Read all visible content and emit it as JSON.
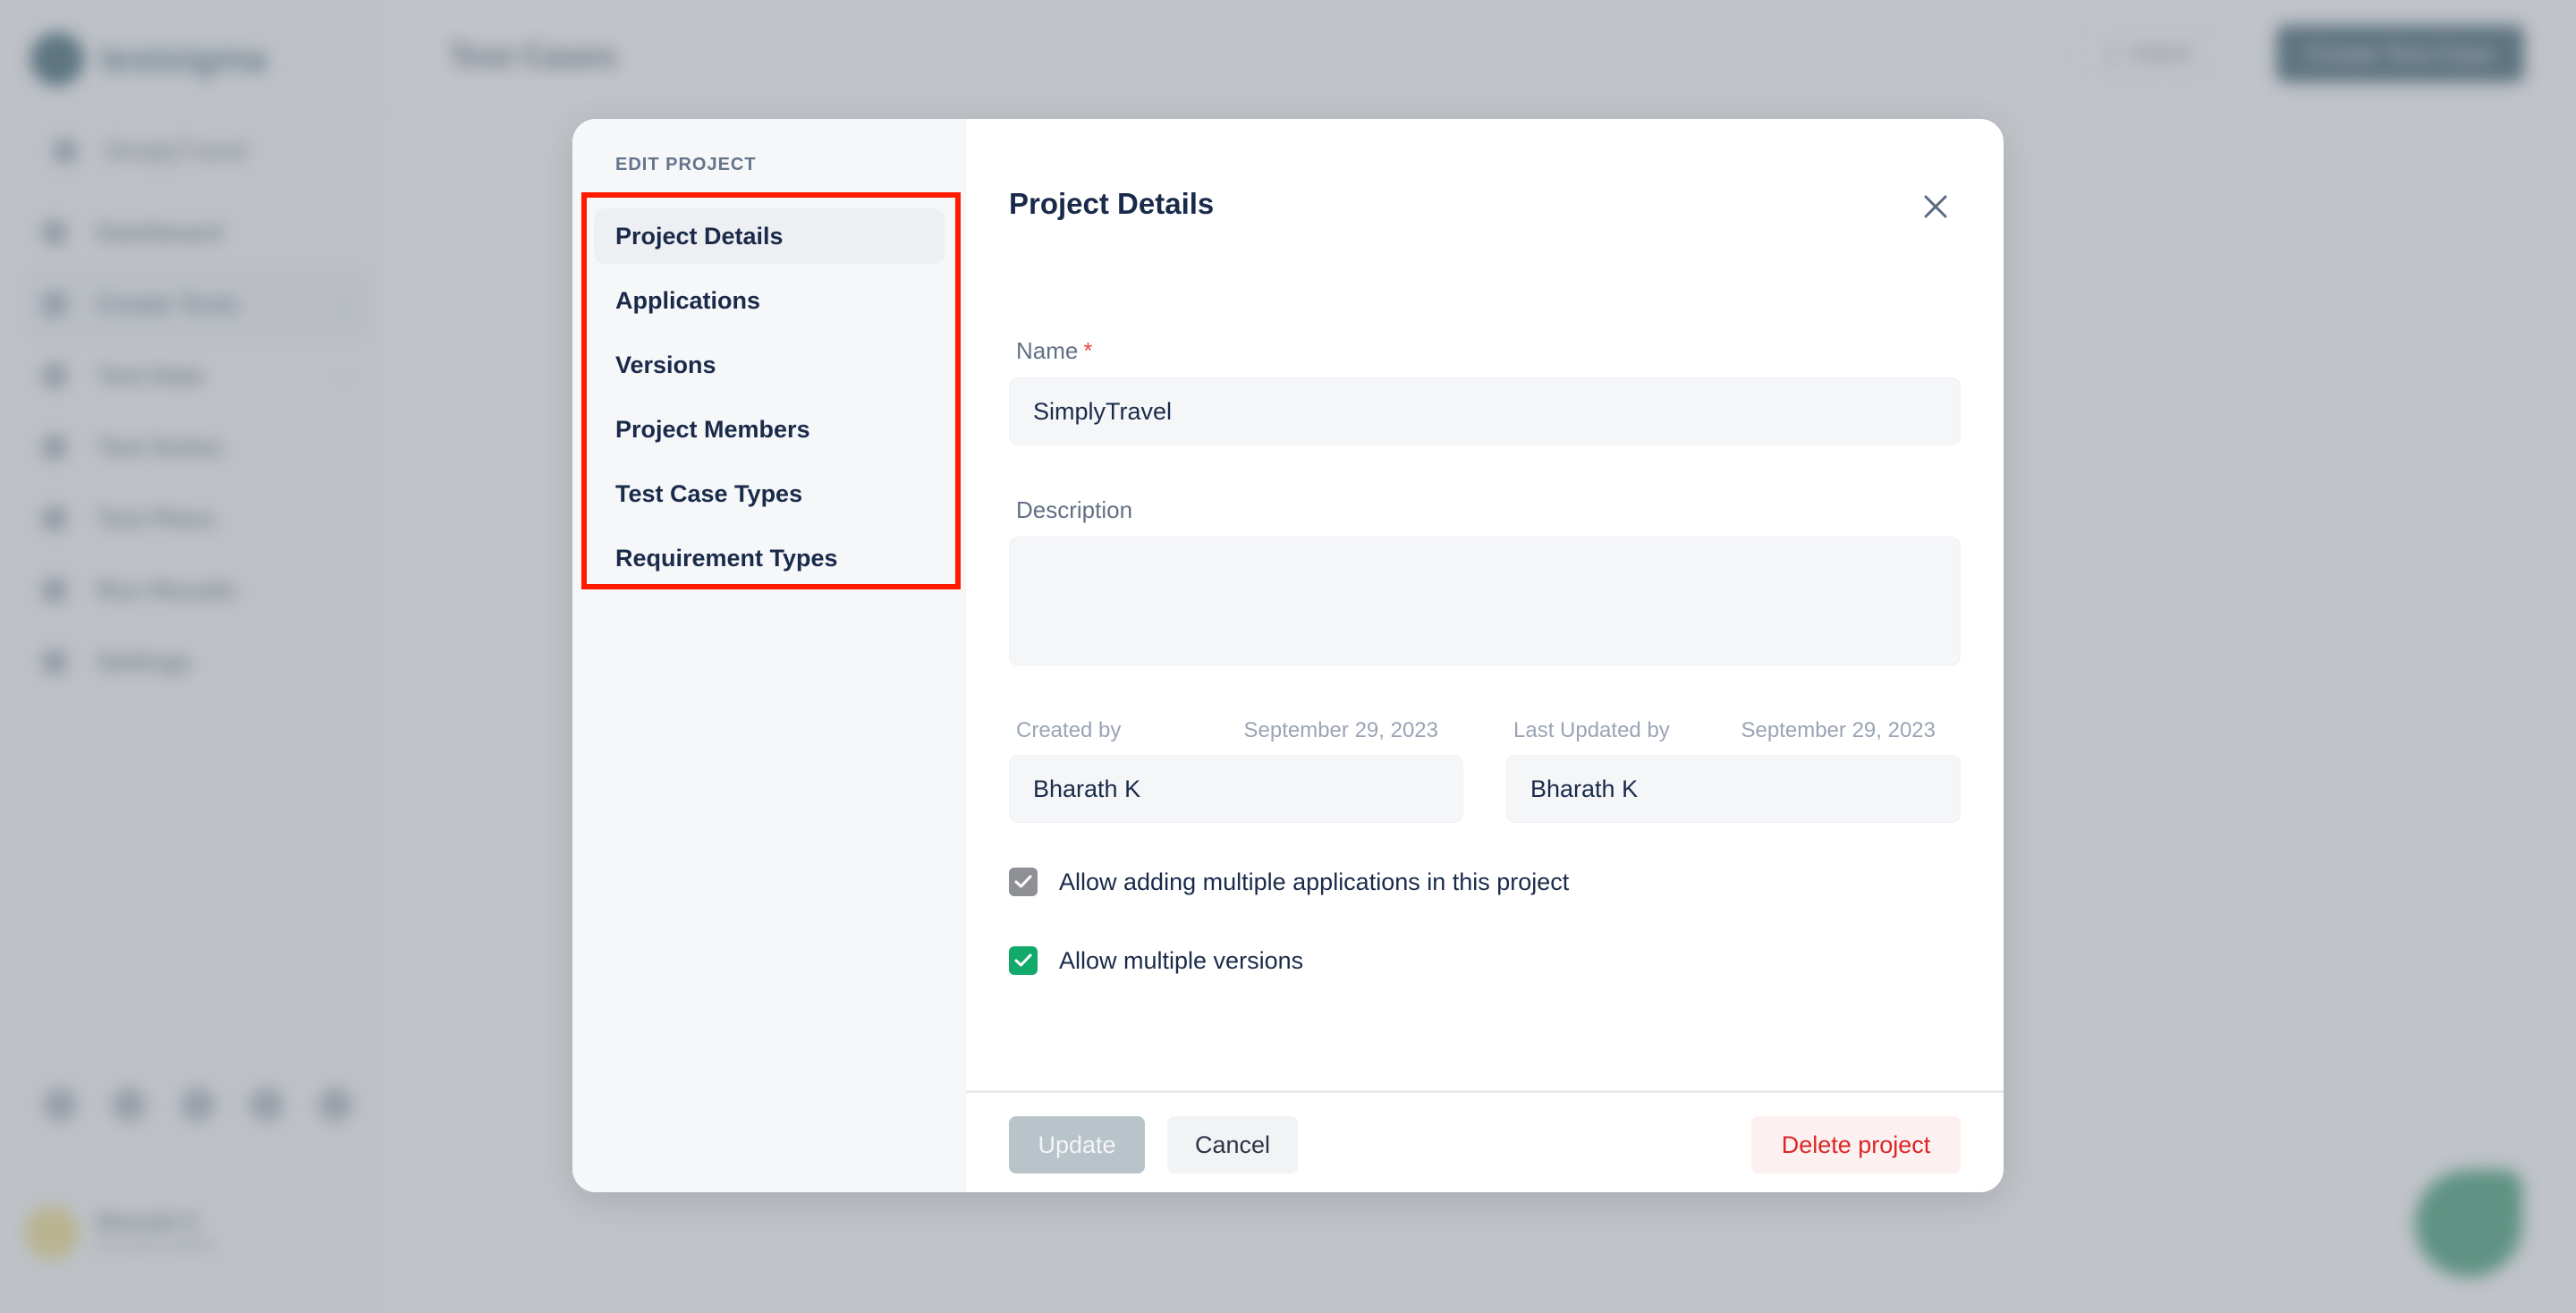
{
  "background": {
    "brand": "testsigma",
    "project_selector": "SimplyTravel",
    "nav": [
      {
        "label": "Dashboard",
        "icon": "dashboard-icon",
        "chevron": false
      },
      {
        "label": "Create Tests",
        "icon": "pen-icon",
        "chevron": true,
        "active": true
      },
      {
        "label": "Test Data",
        "icon": "table-icon",
        "chevron": true
      },
      {
        "label": "Test Suites",
        "icon": "suite-icon",
        "chevron": false
      },
      {
        "label": "Test Plans",
        "icon": "plan-icon",
        "chevron": false
      },
      {
        "label": "Run Results",
        "icon": "results-icon",
        "chevron": false
      },
      {
        "label": "Settings",
        "icon": "gear-icon",
        "chevron": false
      }
    ],
    "user": {
      "name": "Bharath K",
      "subtitle": "Account Admin"
    },
    "page_title": "Test Cases",
    "import_label": "Import",
    "create_label": "Create Test Case"
  },
  "modal": {
    "sidebar_title": "EDIT PROJECT",
    "nav": [
      {
        "label": "Project Details",
        "active": true
      },
      {
        "label": "Applications"
      },
      {
        "label": "Versions"
      },
      {
        "label": "Project Members"
      },
      {
        "label": "Test Case Types"
      },
      {
        "label": "Requirement Types"
      }
    ],
    "title": "Project Details",
    "name_label": "Name",
    "name_required": "*",
    "name_value": "SimplyTravel",
    "description_label": "Description",
    "description_value": "",
    "created_by_label": "Created by",
    "created_date": "September 29, 2023",
    "created_by_value": "Bharath K",
    "updated_by_label": "Last Updated by",
    "updated_date": "September 29, 2023",
    "updated_by_value": "Bharath K",
    "checkboxes": [
      {
        "label": "Allow adding multiple applications in this project",
        "checked": true,
        "disabled": true
      },
      {
        "label": "Allow multiple versions",
        "checked": true,
        "disabled": false
      }
    ],
    "update_label": "Update",
    "cancel_label": "Cancel",
    "delete_label": "Delete project"
  },
  "colors": {
    "accent": "#1c4557",
    "success": "#12a96b",
    "danger": "#dc2626",
    "highlight_box": "#ff1a00"
  }
}
